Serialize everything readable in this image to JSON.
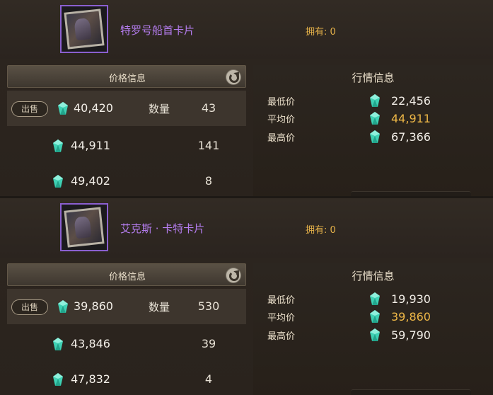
{
  "cards": [
    {
      "name": "特罗号船首卡片",
      "owned_label": "拥有:",
      "owned_count": "0",
      "price_title": "价格信息",
      "sell_label": "出售",
      "qty_label": "数量",
      "listings": [
        {
          "price": "40,420",
          "qty": "43"
        },
        {
          "price": "44,911",
          "qty": "141"
        },
        {
          "price": "49,402",
          "qty": "8"
        }
      ],
      "market_title": "行情信息",
      "stats": [
        {
          "label": "最低价",
          "value": "22,456"
        },
        {
          "label": "平均价",
          "value": "44,911"
        },
        {
          "label": "最高价",
          "value": "67,366"
        }
      ]
    },
    {
      "name": "艾克斯 · 卡特卡片",
      "owned_label": "拥有:",
      "owned_count": "0",
      "price_title": "价格信息",
      "sell_label": "出售",
      "qty_label": "数量",
      "listings": [
        {
          "price": "39,860",
          "qty": "530"
        },
        {
          "price": "43,846",
          "qty": "39"
        },
        {
          "price": "47,832",
          "qty": "4"
        }
      ],
      "market_title": "行情信息",
      "stats": [
        {
          "label": "最低价",
          "value": "19,930"
        },
        {
          "label": "平均价",
          "value": "39,860"
        },
        {
          "label": "最高价",
          "value": "59,790"
        }
      ]
    }
  ],
  "icons": {
    "currency": "gem-icon",
    "refresh": "refresh-icon"
  },
  "colors": {
    "card_name": "#b57df0",
    "owned": "#e6b24a",
    "average_price": "#efb847",
    "gem": "#3fd1b4"
  }
}
